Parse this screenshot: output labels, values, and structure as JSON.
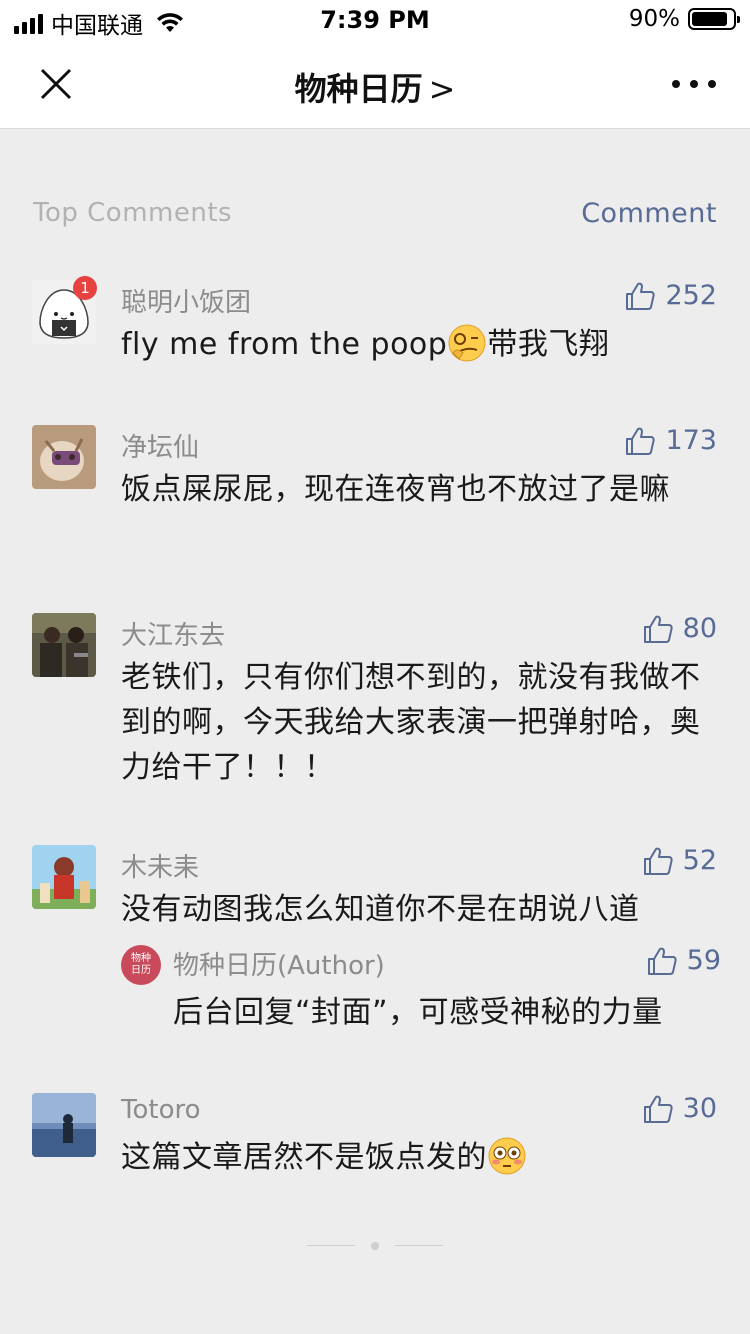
{
  "status_bar": {
    "carrier": "中国联通",
    "time": "7:39 PM",
    "battery": "90%"
  },
  "nav": {
    "title": "物种日历",
    "chevron": ">"
  },
  "section": {
    "title": "Top Comments",
    "comment_link": "Comment"
  },
  "comments": [
    {
      "nick": "聪明小饭团",
      "likes": "252",
      "badge": "1",
      "text": "fly me from the poop",
      "text_after": "带我飞翔",
      "emoji": "smirk-monocle-emoji"
    },
    {
      "nick": "净坛仙",
      "likes": "173",
      "text": "饭点屎尿屁，现在连夜宵也不放过了是嘛"
    },
    {
      "nick": "大江东去",
      "likes": "80",
      "text": "老铁们，只有你们想不到的，就没有我做不到的啊，今天我给大家表演一把弹射哈，奥力给干了！！！"
    },
    {
      "nick": "木未耒",
      "likes": "52",
      "text": "没有动图我怎么知道你不是在胡说八道",
      "reply": {
        "avatar_text_1": "物种",
        "avatar_text_2": "日历",
        "nick": "物种日历(Author)",
        "likes": "59",
        "text": "后台回复“封面”，可感受神秘的力量"
      }
    },
    {
      "nick": "Totoro",
      "likes": "30",
      "text": "这篇文章居然不是饭点发的",
      "emoji": "flushed-emoji"
    }
  ],
  "colors": {
    "link": "#576b95",
    "background": "#ededed",
    "badge": "#e64340"
  }
}
